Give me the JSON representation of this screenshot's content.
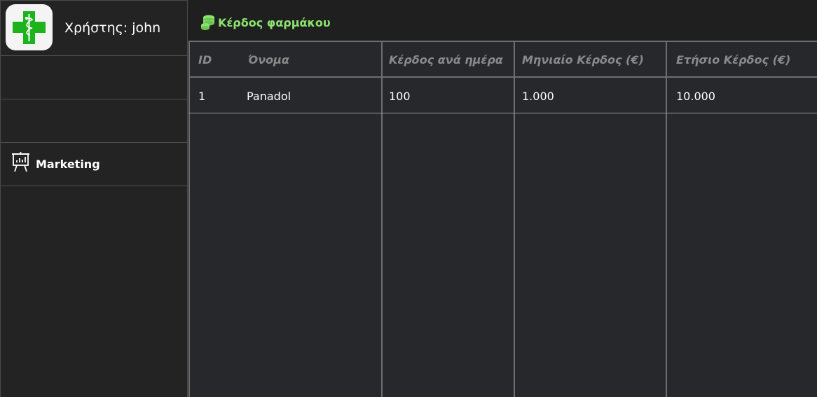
{
  "sidebar": {
    "user_label": "Χρήστης: john",
    "logo_icon": "pharmacy-cross-icon",
    "items": [
      {
        "label": ""
      },
      {
        "label": ""
      },
      {
        "label": "Marketing",
        "icon": "presentation-chart-icon"
      }
    ]
  },
  "header": {
    "title": "Κέρδος φαρμάκου",
    "icon": "coins-icon",
    "accent_color": "#8be36f"
  },
  "table": {
    "columns": [
      "ID",
      "Όνομα",
      "Κέρδος ανά ημέρα",
      "Μηνιαίο Κέρδος (€)",
      "Ετήσιο Κέρδος (€)"
    ],
    "rows": [
      [
        "1",
        "Panadol",
        "100",
        "1.000",
        "10.000"
      ]
    ]
  }
}
